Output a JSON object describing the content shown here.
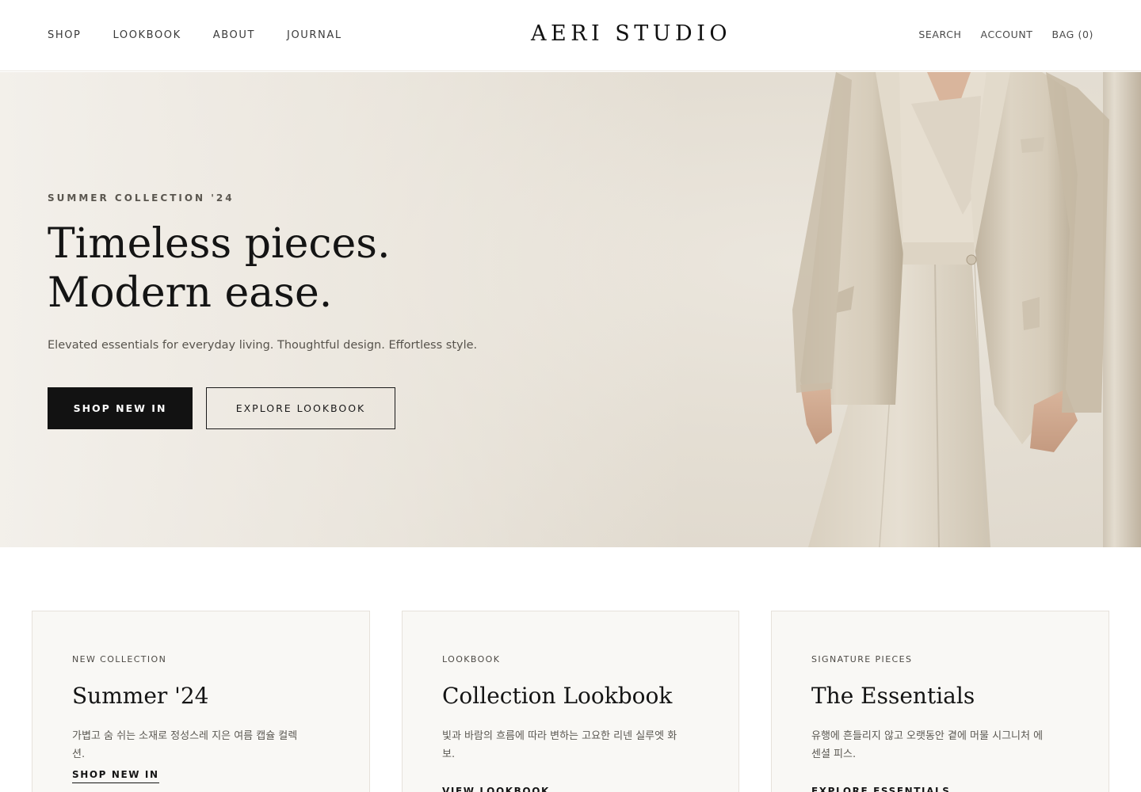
{
  "header": {
    "nav_left": [
      "SHOP",
      "LOOKBOOK",
      "ABOUT",
      "JOURNAL"
    ],
    "logo": "AERI STUDIO",
    "nav_right": {
      "search": "SEARCH",
      "account": "ACCOUNT",
      "bag": "BAG (0)"
    }
  },
  "hero": {
    "eyebrow": "SUMMER COLLECTION '24",
    "headline_line1": "Timeless pieces.",
    "headline_line2": "Modern ease.",
    "subline": "Elevated essentials for everyday living. Thoughtful design. Effortless style.",
    "primary_cta": "SHOP NEW IN",
    "secondary_cta": "EXPLORE LOOKBOOK"
  },
  "cards": [
    {
      "eyebrow": "NEW COLLECTION",
      "title": "Summer '24",
      "desc": "가볍고 숨 쉬는 소재로 정성스레 지은 여름 캡슐 컬렉션.",
      "link": "SHOP NEW IN"
    },
    {
      "eyebrow": "LOOKBOOK",
      "title": "Collection Lookbook",
      "desc": "빛과 바람의 흐름에 따라 변하는 고요한 리넨 실루엣 화보.",
      "link": "VIEW LOOKBOOK"
    },
    {
      "eyebrow": "SIGNATURE PIECES",
      "title": "The Essentials",
      "desc": "유행에 흔들리지 않고 오랫동안 곁에 머물 시그니처 에센셜 피스.",
      "link": "EXPLORE ESSENTIALS"
    }
  ],
  "colors": {
    "primary": "#121212",
    "hero_bg": "#e4ded3",
    "card_bg": "#f9f8f5",
    "linen": "#d8cfbf"
  }
}
